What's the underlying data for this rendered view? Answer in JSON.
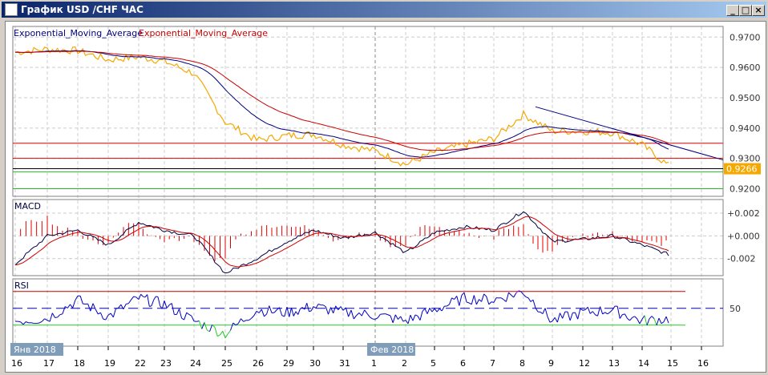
{
  "window": {
    "title": "График USD /CHF  ЧАС",
    "minimize": "_",
    "maximize": "□",
    "close": "×"
  },
  "legend": {
    "ema1": "Exponential_Moving_Average",
    "ema2": "Exponential_Moving_Average"
  },
  "colors": {
    "price": "#f5a800",
    "ema_fast": "#000080",
    "ema_slow": "#cc0000",
    "macd": "#000040",
    "signal": "#cc0000",
    "hist": "#dd0000",
    "rsi": "#0000c0",
    "rsi_low": "#22cc22",
    "rsi_high": "#e000e0"
  },
  "price_axis": [
    "0.9700",
    "0.9600",
    "0.9500",
    "0.9400",
    "0.9300",
    "0.9200"
  ],
  "last_price": "0.9266",
  "macd_panel": {
    "label": "MACD",
    "ticks": [
      "+0.002",
      "+0.000",
      "-0.002"
    ]
  },
  "rsi_panel": {
    "label": "RSI",
    "ticks": [
      "50"
    ]
  },
  "month_labels": {
    "jan": "Янв 2018",
    "feb": "Фев 2018"
  },
  "dates": [
    "16",
    "17",
    "18",
    "19",
    "22",
    "23",
    "24",
    "25",
    "26",
    "29",
    "30",
    "31",
    "1",
    "2",
    "5",
    "6",
    "7",
    "8",
    "9",
    "12",
    "13",
    "14",
    "15",
    "16"
  ],
  "chart_data": {
    "type": "line",
    "x": [
      "16",
      "17",
      "18",
      "19",
      "22",
      "23",
      "24",
      "25",
      "26",
      "29",
      "30",
      "31",
      "1",
      "2",
      "5",
      "6",
      "7",
      "8",
      "9",
      "12",
      "13",
      "14",
      "15"
    ],
    "price": [
      0.965,
      0.966,
      0.9655,
      0.9625,
      0.9635,
      0.962,
      0.958,
      0.942,
      0.936,
      0.9375,
      0.938,
      0.9345,
      0.9325,
      0.928,
      0.932,
      0.9345,
      0.9365,
      0.9445,
      0.939,
      0.939,
      0.9385,
      0.9345,
      0.927
    ],
    "macd": [
      -0.0025,
      0,
      0.0005,
      -0.0008,
      0.0012,
      0.0005,
      0,
      -0.0033,
      -0.002,
      -0.0005,
      0.0005,
      -0.0002,
      0.0003,
      -0.0015,
      0.0003,
      0.0008,
      0.0005,
      0.0022,
      -0.0005,
      -0.0003,
      0,
      -0.0008,
      -0.0017
    ],
    "rsi": [
      35,
      38,
      60,
      40,
      62,
      55,
      35,
      20,
      48,
      45,
      52,
      45,
      42,
      35,
      48,
      62,
      60,
      70,
      35,
      45,
      48,
      35,
      38
    ],
    "levels": {
      "red": [
        0.935,
        0.93
      ],
      "black": 0.9266,
      "green": [
        0.9256,
        0.92
      ]
    },
    "trendline": [
      [
        "8",
        0.947
      ],
      [
        "16",
        0.9295
      ]
    ],
    "price_range": [
      0.9175,
      0.9735
    ],
    "macd_range": [
      -0.0035,
      0.0032
    ],
    "rsi_range": [
      5,
      85
    ],
    "rsi_levels": [
      30,
      50,
      70
    ]
  }
}
